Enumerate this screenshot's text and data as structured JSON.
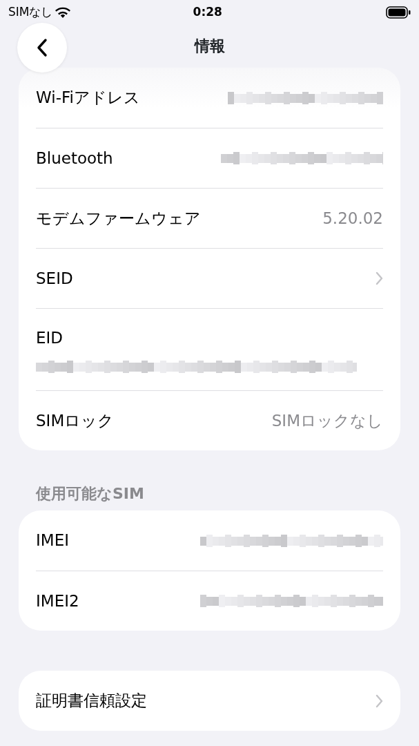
{
  "status_bar": {
    "carrier": "SIMなし",
    "time": "0:28"
  },
  "nav": {
    "title": "情報"
  },
  "sections": [
    {
      "rows": [
        {
          "label": "Wi-Fiアドレス",
          "kind": "redacted"
        },
        {
          "label": "Bluetooth",
          "kind": "redacted"
        },
        {
          "label": "モデムファームウェア",
          "kind": "value",
          "value": "5.20.02"
        },
        {
          "label": "SEID",
          "kind": "link"
        },
        {
          "label": "EID",
          "kind": "redacted_below"
        },
        {
          "label": "SIMロック",
          "kind": "value",
          "value": "SIMロックなし"
        }
      ]
    },
    {
      "header": "使用可能なSIM",
      "rows": [
        {
          "label": "IMEI",
          "kind": "redacted"
        },
        {
          "label": "IMEI2",
          "kind": "redacted"
        }
      ]
    },
    {
      "rows": [
        {
          "label": "証明書信頼設定",
          "kind": "link"
        }
      ]
    }
  ]
}
